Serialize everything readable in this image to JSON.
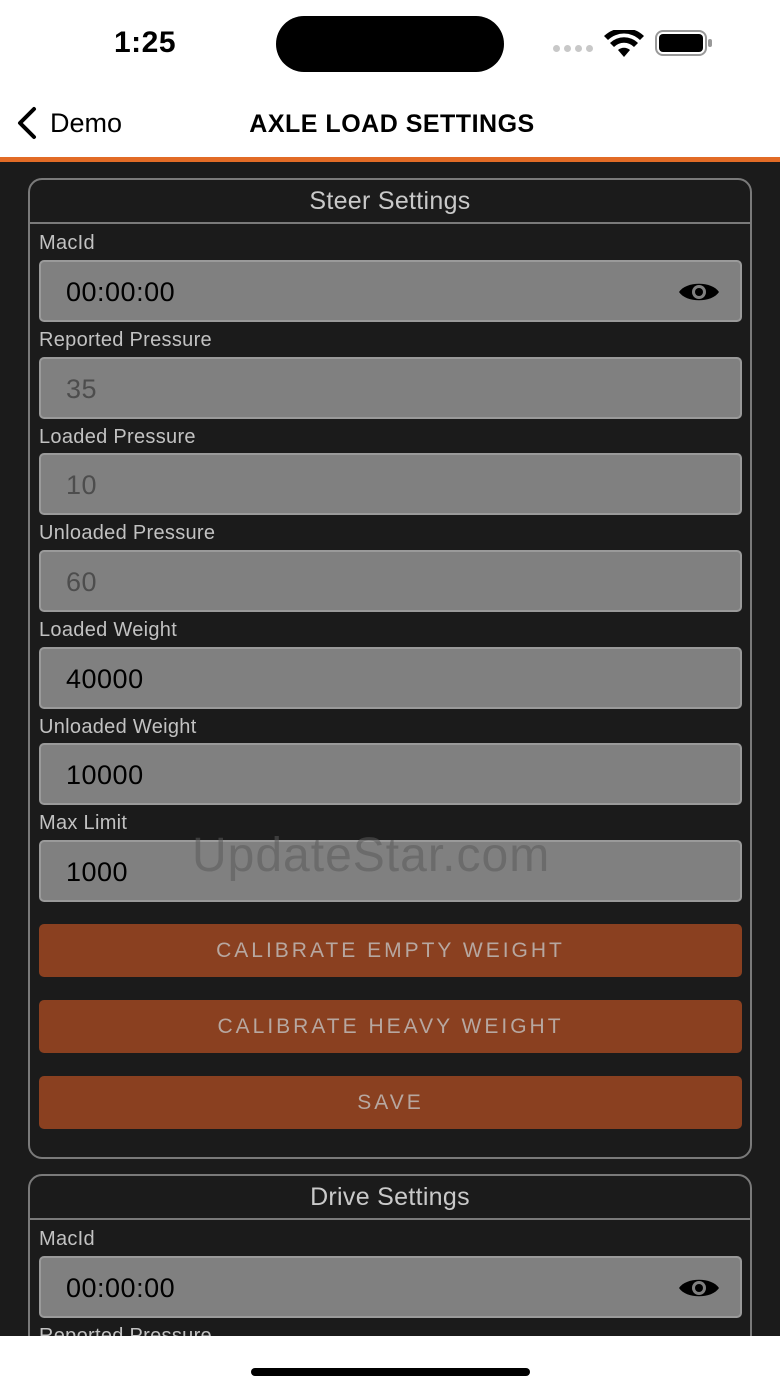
{
  "status_bar": {
    "time": "1:25"
  },
  "nav": {
    "back_label": "Demo",
    "title": "AXLE LOAD SETTINGS"
  },
  "steer": {
    "header": "Steer Settings",
    "fields": [
      {
        "label": "MacId",
        "value": "00:00:00"
      },
      {
        "label": "Reported Pressure",
        "value": "35"
      },
      {
        "label": "Loaded Pressure",
        "value": "10"
      },
      {
        "label": "Unloaded Pressure",
        "value": "60"
      },
      {
        "label": "Loaded Weight",
        "value": "40000"
      },
      {
        "label": "Unloaded Weight",
        "value": "10000"
      },
      {
        "label": "Max Limit",
        "value": "1000"
      }
    ],
    "buttons": {
      "calibrate_empty": "CALIBRATE EMPTY WEIGHT",
      "calibrate_heavy": "CALIBRATE HEAVY WEIGHT",
      "save": "SAVE"
    }
  },
  "drive": {
    "header": "Drive Settings",
    "fields": [
      {
        "label": "MacId",
        "value": "00:00:00"
      },
      {
        "label": "Reported Pressure",
        "value": ""
      }
    ]
  },
  "watermark": "UpdateStar.com",
  "colors": {
    "accent": "#e26b26",
    "button": "#8a4020",
    "field": "#808080",
    "background": "#1b1b1b"
  },
  "icons": [
    "back-chevron-icon",
    "eye-icon",
    "wifi-icon",
    "battery-icon"
  ]
}
